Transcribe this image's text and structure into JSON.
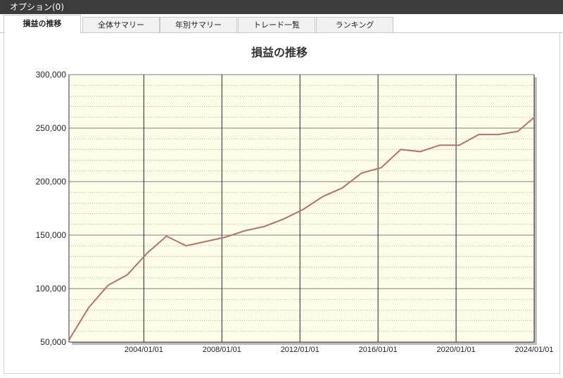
{
  "window": {
    "title": "オプション(0)"
  },
  "tabs": [
    {
      "label": "損益の推移",
      "active": true
    },
    {
      "label": "全体サマリー",
      "active": false
    },
    {
      "label": "年別サマリー",
      "active": false
    },
    {
      "label": "トレード一覧",
      "active": false
    },
    {
      "label": "ランキング",
      "active": false
    }
  ],
  "colors": {
    "plot_background": "#fefde9",
    "line": "#b86f6a",
    "titlebar": "#3c3c3c"
  },
  "chart_data": {
    "type": "line",
    "title": "損益の推移",
    "xlabel": "",
    "ylabel": "",
    "x_axis_type": "date",
    "xlim": [
      "2000/03/01",
      "2024/01/01"
    ],
    "ylim": [
      50000,
      300000
    ],
    "y_ticks": [
      50000,
      100000,
      150000,
      200000,
      250000,
      300000
    ],
    "y_tick_labels": [
      "50,000",
      "100,000",
      "150,000",
      "200,000",
      "250,000",
      "300,000"
    ],
    "x_ticks": [
      "2004/01/01",
      "2008/01/01",
      "2012/01/01",
      "2016/01/01",
      "2020/01/01",
      "2024/01/01"
    ],
    "grid": {
      "major_vertical": true,
      "minor_horizontal": true
    },
    "legend": "none",
    "series": [
      {
        "x": [
          "2000/03/01",
          "2001/03/01",
          "2002/03/01",
          "2003/03/01",
          "2004/03/01",
          "2005/03/01",
          "2006/03/01",
          "2007/03/01",
          "2008/03/01",
          "2009/03/01",
          "2010/03/01",
          "2011/03/01",
          "2012/03/01",
          "2013/03/01",
          "2014/03/01",
          "2015/03/01",
          "2016/03/01",
          "2017/03/01",
          "2018/03/01",
          "2019/03/01",
          "2020/03/01",
          "2021/03/01",
          "2022/03/01",
          "2023/03/01",
          "2024/01/01"
        ],
        "y": [
          52000,
          82000,
          103000,
          113000,
          133000,
          149000,
          140000,
          144000,
          148000,
          154000,
          158000,
          165000,
          174000,
          186000,
          194000,
          208000,
          213000,
          230000,
          228000,
          234000,
          234000,
          244000,
          244000,
          247000,
          260000
        ]
      }
    ]
  }
}
